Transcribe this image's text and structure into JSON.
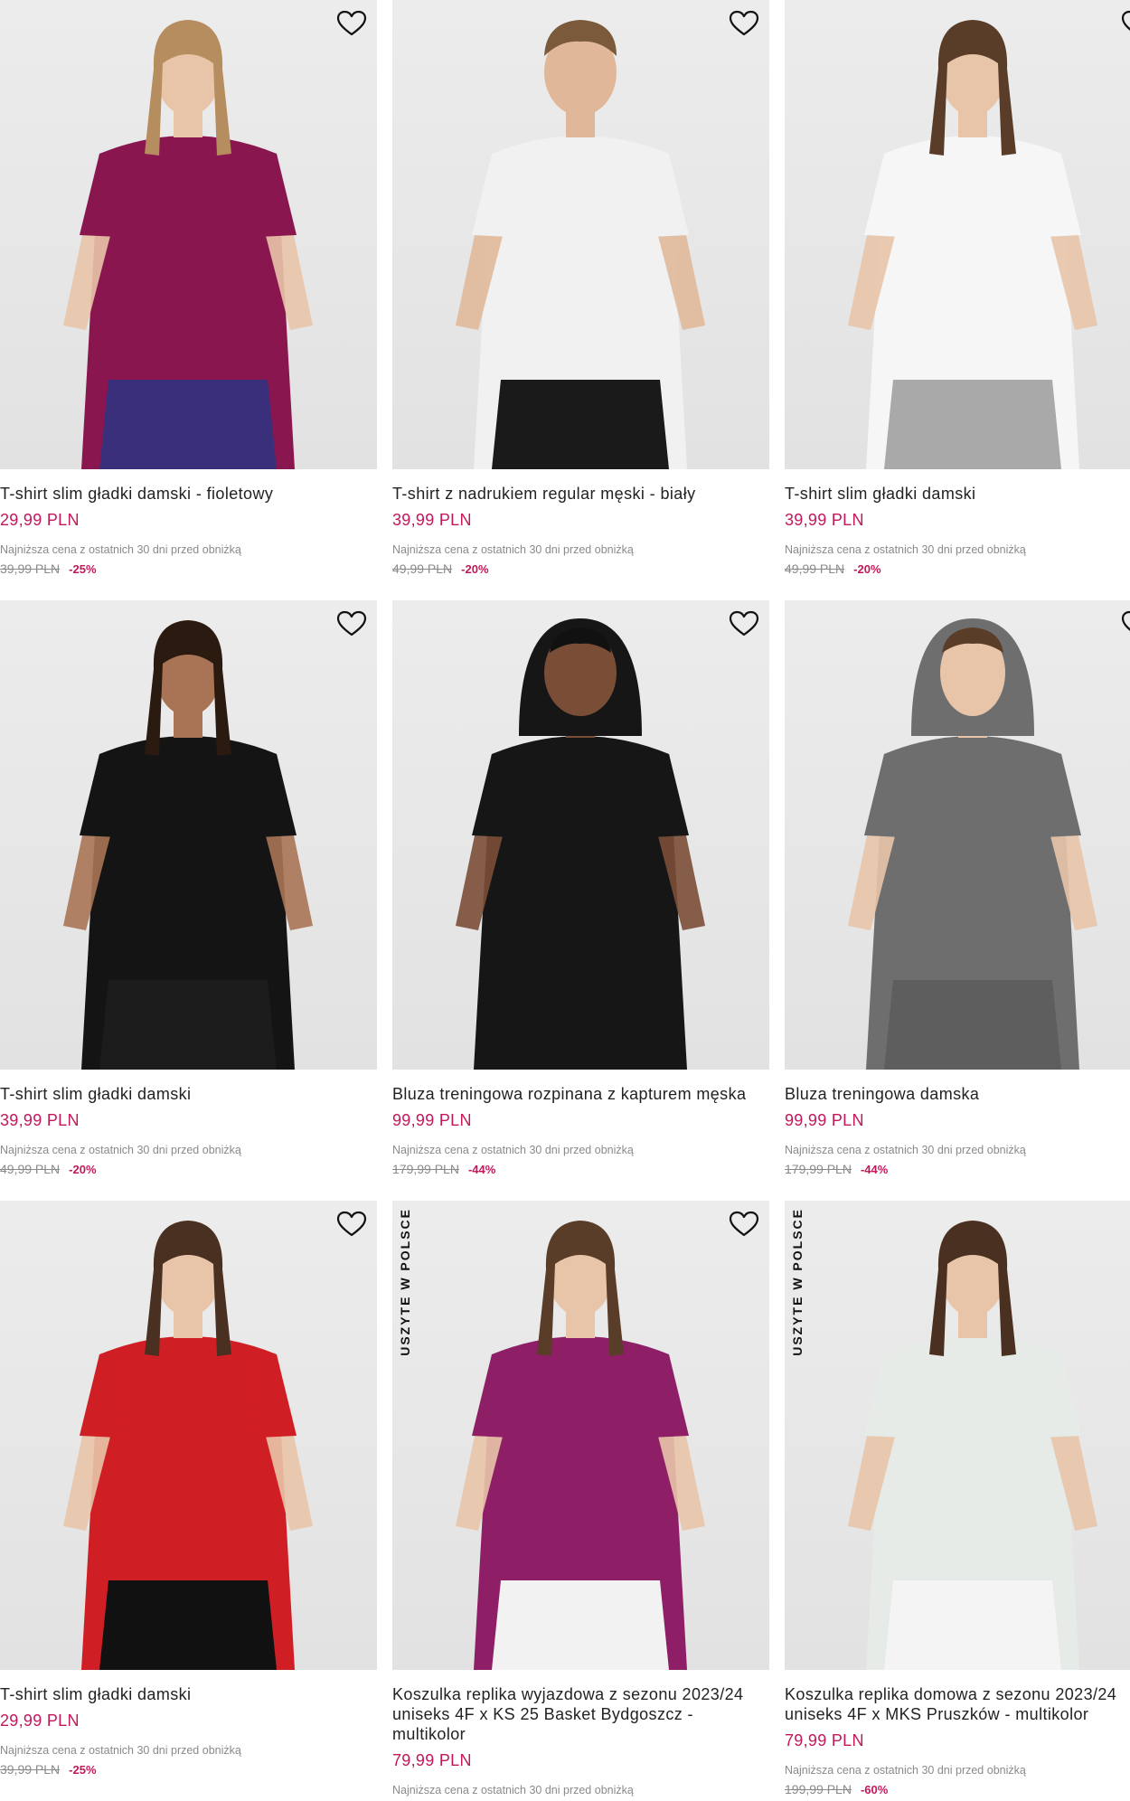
{
  "products": [
    {
      "title": "T-shirt slim gładki damski - fioletowy",
      "price": "29,99 PLN",
      "hint": "Najniższa cena z ostatnich 30 dni przed obniżką",
      "old_price": "39,99 PLN",
      "discount": "-25%",
      "badge": "",
      "colors": {
        "top": "#8a1650",
        "bottom": "#3a2f7a",
        "hair": "#b58d5e",
        "skin": "#e8c4a8"
      }
    },
    {
      "title": "T-shirt z nadrukiem regular męski - biały",
      "price": "39,99 PLN",
      "hint": "Najniższa cena z ostatnich 30 dni przed obniżką",
      "old_price": "49,99 PLN",
      "discount": "-20%",
      "badge": "",
      "colors": {
        "top": "#f1f1f1",
        "bottom": "#1a1a1a",
        "hair": "#7a5a3a",
        "skin": "#e0b899"
      }
    },
    {
      "title": "T-shirt slim gładki damski",
      "price": "39,99 PLN",
      "hint": "Najniższa cena z ostatnich 30 dni przed obniżką",
      "old_price": "49,99 PLN",
      "discount": "-20%",
      "badge": "",
      "colors": {
        "top": "#f6f6f6",
        "bottom": "#a9a9a9",
        "hair": "#5a3d28",
        "skin": "#e8c4a8"
      }
    },
    {
      "title": "T-shirt slim gładki damski",
      "price": "39,99 PLN",
      "hint": "Najniższa cena z ostatnich 30 dni przed obniżką",
      "old_price": "49,99 PLN",
      "discount": "-20%",
      "badge": "",
      "colors": {
        "top": "#141414",
        "bottom": "#1c1c1c",
        "hair": "#2a1a10",
        "skin": "#a97455"
      }
    },
    {
      "title": "Bluza treningowa rozpinana z kapturem męska",
      "price": "99,99 PLN",
      "hint": "Najniższa cena z ostatnich 30 dni przed obniżką",
      "old_price": "179,99 PLN",
      "discount": "-44%",
      "badge": "",
      "colors": {
        "top": "#161616",
        "bottom": "#161616",
        "hair": "#111111",
        "skin": "#7a4e36"
      }
    },
    {
      "title": "Bluza treningowa damska",
      "price": "99,99 PLN",
      "hint": "Najniższa cena z ostatnich 30 dni przed obniżką",
      "old_price": "179,99 PLN",
      "discount": "-44%",
      "badge": "",
      "colors": {
        "top": "#6e6e6e",
        "bottom": "#5e5e5e",
        "hair": "#5a3d28",
        "skin": "#e8c4a8"
      }
    },
    {
      "title": "T-shirt slim gładki damski",
      "price": "29,99 PLN",
      "hint": "Najniższa cena z ostatnich 30 dni przed obniżką",
      "old_price": "39,99 PLN",
      "discount": "-25%",
      "badge": "",
      "colors": {
        "top": "#d01f24",
        "bottom": "#111111",
        "hair": "#4a3020",
        "skin": "#e8c4a8"
      }
    },
    {
      "title": "Koszulka replika wyjazdowa z sezonu 2023/24 uniseks 4F x KS 25 Basket Bydgoszcz - multikolor",
      "price": "79,99 PLN",
      "hint": "Najniższa cena z ostatnich 30 dni przed obniżką",
      "old_price": "",
      "discount": "",
      "badge": "USZYTE W POLSCE",
      "colors": {
        "top": "#8e1f66",
        "bottom": "#f2f2f2",
        "hair": "#5a3d28",
        "skin": "#e8c4a8"
      }
    },
    {
      "title": "Koszulka replika domowa z sezonu 2023/24 uniseks 4F x MKS Pruszków - multikolor",
      "price": "79,99 PLN",
      "hint": "Najniższa cena z ostatnich 30 dni przed obniżką",
      "old_price": "199,99 PLN",
      "discount": "-60%",
      "badge": "USZYTE W POLSCE",
      "colors": {
        "top": "#e6ebe8",
        "bottom": "#f4f4f4",
        "hair": "#4a3020",
        "skin": "#e8c4a8"
      }
    }
  ]
}
